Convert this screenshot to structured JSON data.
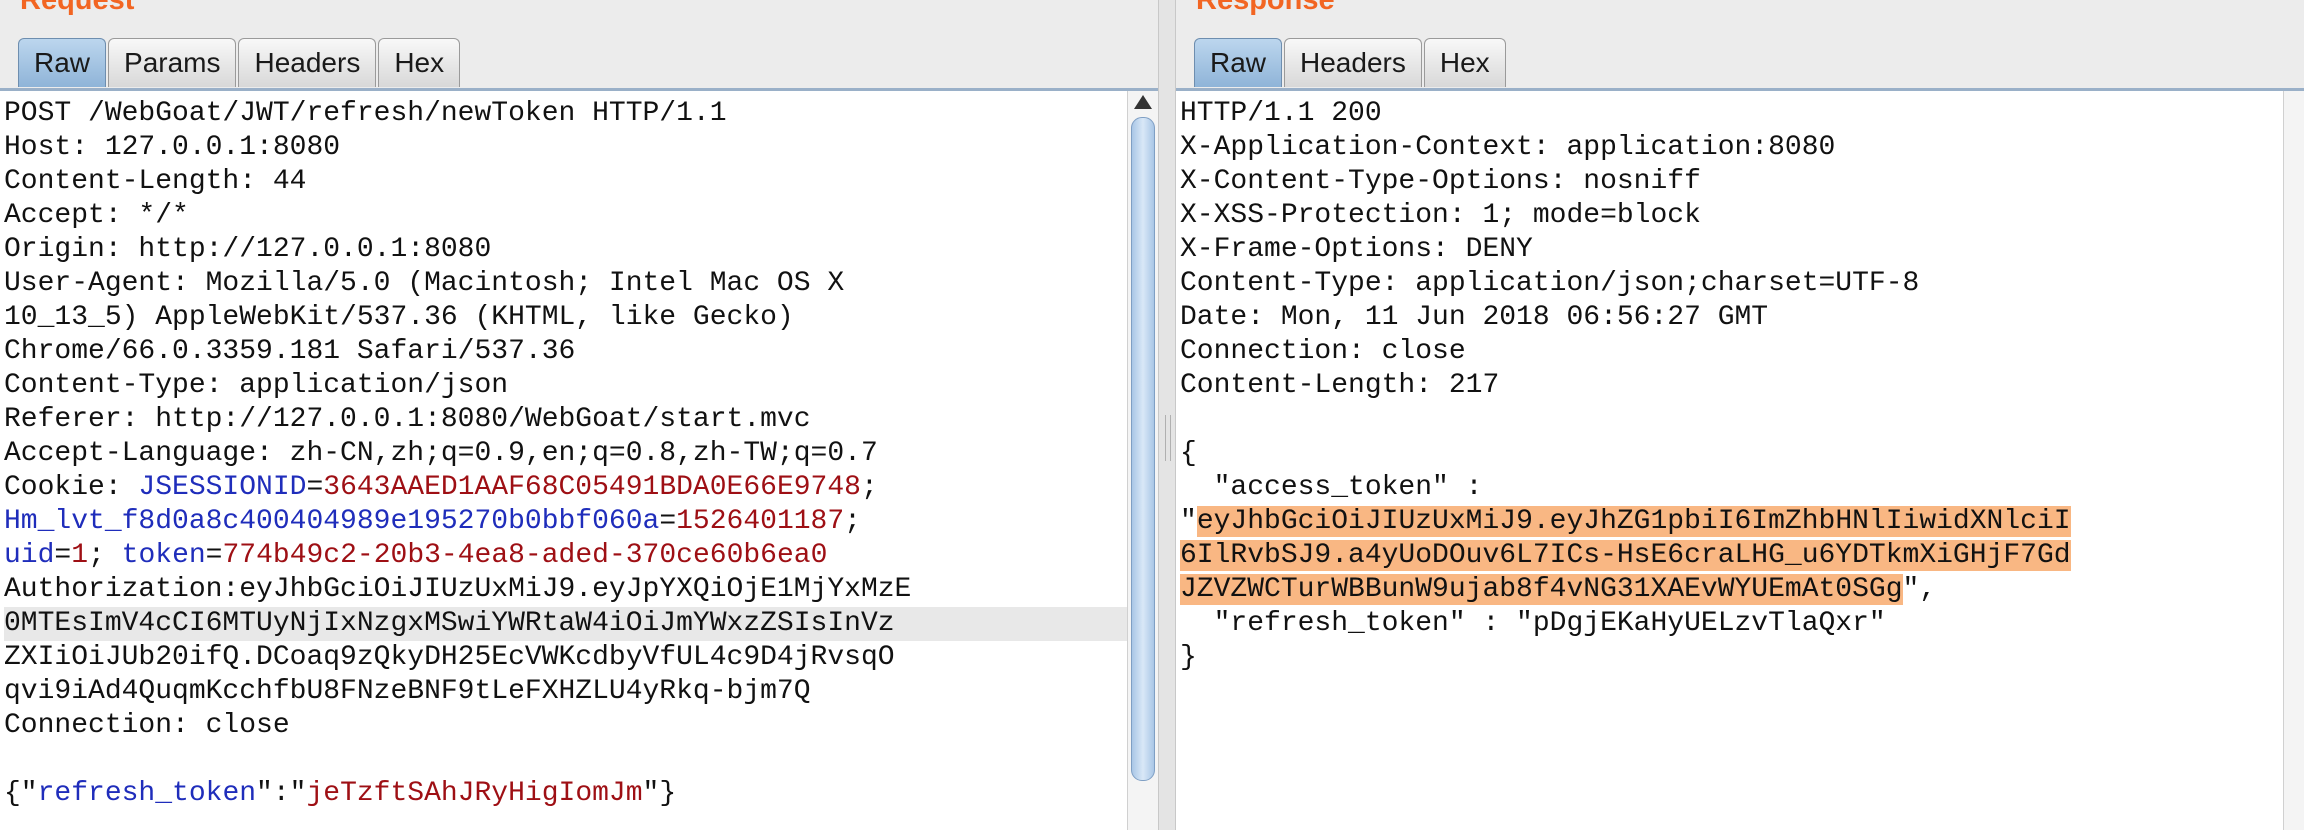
{
  "request": {
    "title": "Request",
    "tabs": [
      "Raw",
      "Params",
      "Headers",
      "Hex"
    ],
    "lines": {
      "l0": "POST /WebGoat/JWT/refresh/newToken HTTP/1.1",
      "l1": "Host: 127.0.0.1:8080",
      "l2": "Content-Length: 44",
      "l3": "Accept: */*",
      "l4": "Origin: http://127.0.0.1:8080",
      "l5": "User-Agent: Mozilla/5.0 (Macintosh; Intel Mac OS X",
      "l6": "10_13_5) AppleWebKit/537.36 (KHTML, like Gecko)",
      "l7": "Chrome/66.0.3359.181 Safari/537.36",
      "l8": "Content-Type: application/json",
      "l9": "Referer: http://127.0.0.1:8080/WebGoat/start.mvc",
      "l10": "Accept-Language: zh-CN,zh;q=0.9,en;q=0.8,zh-TW;q=0.7",
      "l16": "ZXIiOiJUb20ifQ.DCoaq9zQkyDH25EcVWKcdbyVfUL4c9D4jRvsqO",
      "l17": "qvi9iAd4QuqmKcchfbU8FNzeBNF9tLeFXHZLU4yRkq-bjm7Q",
      "l18": "Connection: close"
    },
    "cookie": {
      "label": "Cookie: ",
      "c1_name": "JSESSIONID",
      "c1_value": "3643AAED1AAF68C05491BDA0E66E9748",
      "c2_name": "Hm_lvt_f8d0a8c400404989e195270b0bbf060a",
      "c2_value": "1526401187",
      "c3_name": "uid",
      "c3_value": "1",
      "c4_name": "token",
      "c4_value": "774b49c2-20b3-4ea8-aded-370ce60b6ea0"
    },
    "auth_line1": "Authorization:eyJhbGciOiJIUzUxMiJ9.eyJpYXQiOjE1MjYxMzE",
    "auth_line2": "0MTEsImV4cCI6MTUyNjIxNzgxMSwiYWRtaW4iOiJmYWxzZSIsInVz",
    "body": {
      "key": "refresh_token",
      "value": "jeTzftSAhJRyHigIomJm"
    }
  },
  "response": {
    "title": "Response",
    "tabs": [
      "Raw",
      "Headers",
      "Hex"
    ],
    "lines": {
      "l0": "HTTP/1.1 200",
      "l1": "X-Application-Context: application:8080",
      "l2": "X-Content-Type-Options: nosniff",
      "l3": "X-XSS-Protection: 1; mode=block",
      "l4": "X-Frame-Options: DENY",
      "l5": "Content-Type: application/json;charset=UTF-8",
      "l6": "Date: Mon, 11 Jun 2018 06:56:27 GMT",
      "l7": "Connection: close",
      "l8": "Content-Length: 217",
      "l10": "{",
      "l11": "  \"access_token\" :",
      "l15": "  \"refresh_token\" : \"pDgjEKaHyUELzvTlaQxr\"",
      "l16": "}"
    },
    "token_line1": "eyJhbGciOiJIUzUxMiJ9.eyJhZG1pbiI6ImZhbHNlIiwidXNlciI",
    "token_line2": "6IlRvbSJ9.a4yUoDOuv6L7ICs-HsE6craLHG_u6YDTkmXiGHjF7Gd",
    "token_line3": "JZVZWCTurWBBunW9ujab8f4vNG31XAEvWYUEmAt0SGg"
  },
  "colors": {
    "title_accent": "#f26522",
    "active_tab": "#a3c4e4",
    "highlight": "#f9b783",
    "syntax_blue": "#1f2dbb",
    "syntax_red": "#9e0f14"
  }
}
